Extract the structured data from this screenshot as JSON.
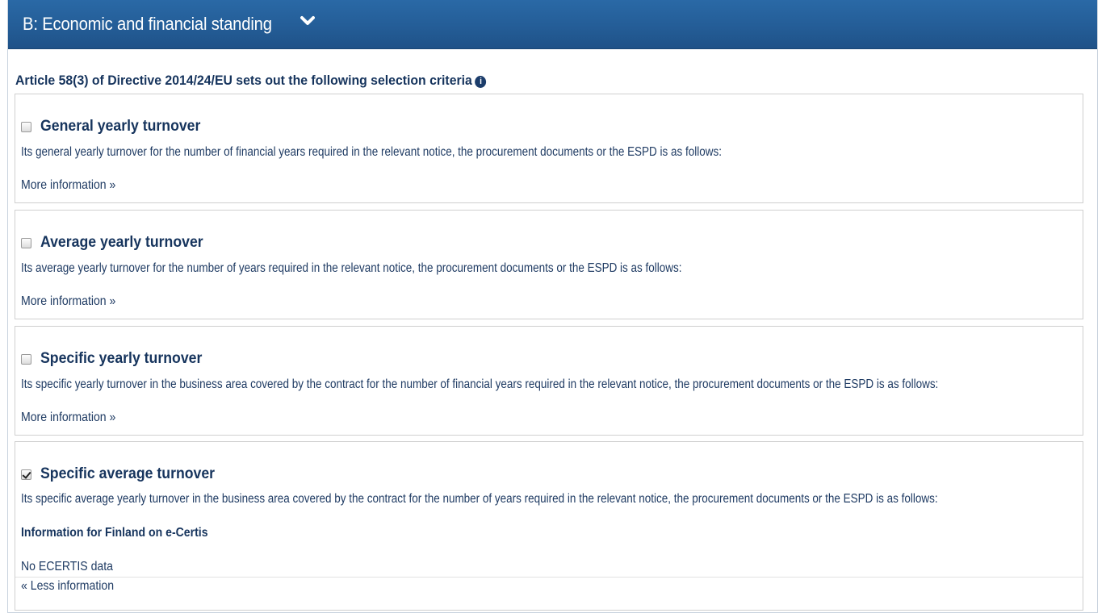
{
  "section": {
    "title": "B: Economic and financial standing",
    "intro": "Article 58(3) of Directive 2014/24/EU sets out the following selection criteria"
  },
  "criteria": [
    {
      "title": "General yearly turnover",
      "checked": false,
      "description": "Its general yearly turnover for the number of financial years required in the relevant notice, the procurement documents or the ESPD is as follows:",
      "toggle": "More information »"
    },
    {
      "title": "Average yearly turnover",
      "checked": false,
      "description": "Its average yearly turnover for the number of years required in the relevant notice, the procurement documents or the ESPD is as follows:",
      "toggle": "More information »"
    },
    {
      "title": "Specific yearly turnover",
      "checked": false,
      "description": "Its specific yearly turnover in the business area covered by the contract for the number of financial years required in the relevant notice, the procurement documents or the ESPD is as follows:",
      "toggle": "More information »"
    },
    {
      "title": "Specific average turnover",
      "checked": true,
      "description": "Its specific average yearly turnover in the business area covered by the contract for the number of years required in the relevant notice, the procurement documents or the ESPD is as follows:",
      "ecertis_heading": "Information for Finland on e-Certis",
      "ecertis_text": "No ECERTIS data",
      "toggle": "« Less information"
    }
  ]
}
